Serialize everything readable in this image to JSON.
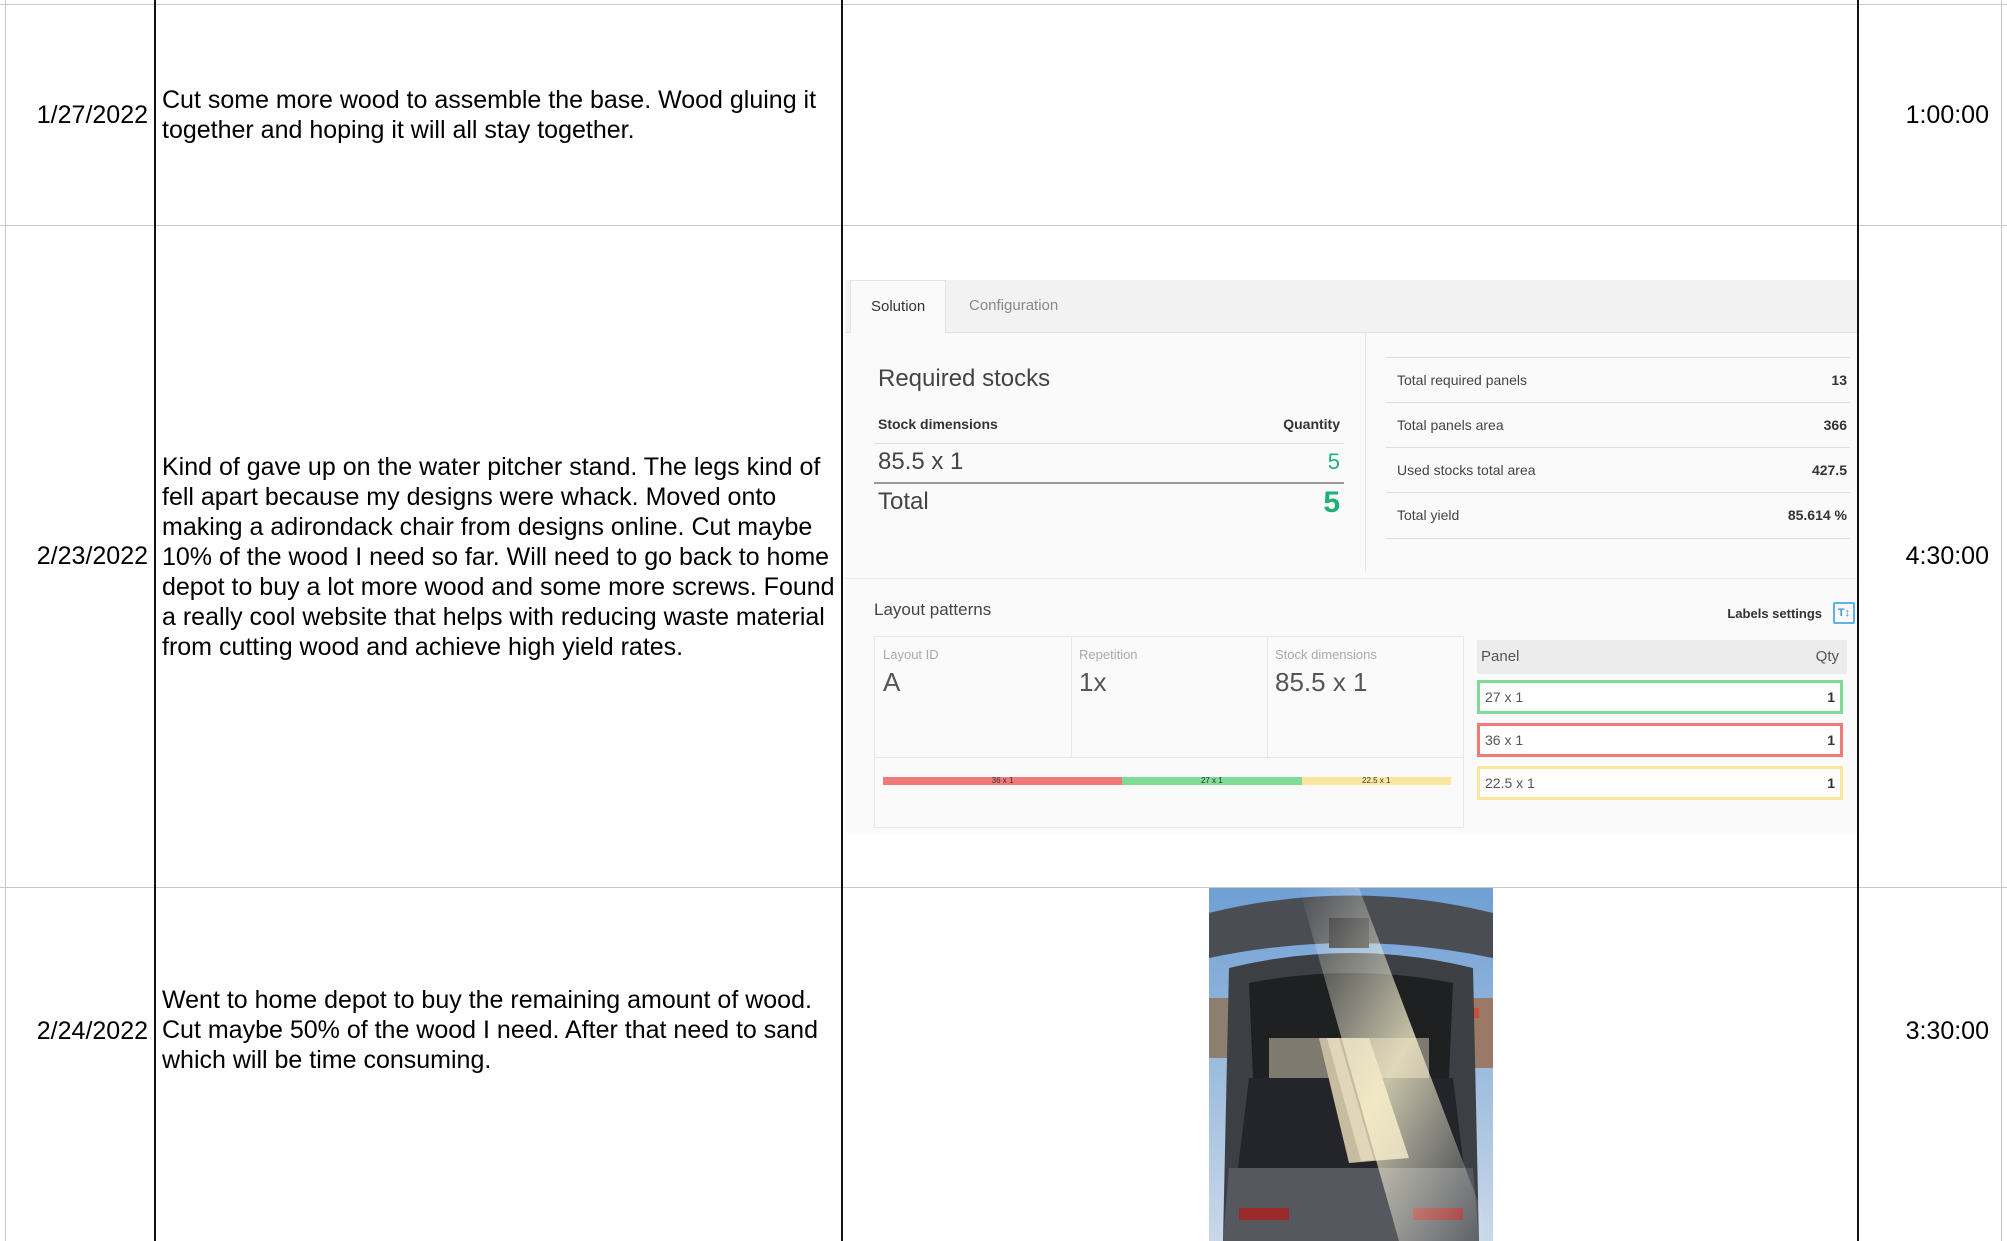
{
  "rows": [
    {
      "date": "1/27/2022",
      "description": "Cut some more wood to assemble the base. Wood gluing it together and hoping it will all stay together.",
      "duration": "1:00:00"
    },
    {
      "date": "2/23/2022",
      "description": "Kind of gave up on the water pitcher stand. The legs kind of fell apart because my designs were whack. Moved onto making a adirondack chair from designs online. Cut maybe 10% of the wood I need so far. Will need to go back to home depot to buy a lot more wood and some more screws. Found a really cool website that helps with reducing waste material from cutting wood and achieve high yield rates.",
      "duration": "4:30:00"
    },
    {
      "date": "2/24/2022",
      "description": "Went to home depot to buy the remaining amount of wood. Cut maybe 50% of the wood I need. After that need to sand which will be time consuming.",
      "duration": "3:30:00"
    }
  ],
  "cutlist_app": {
    "tabs": [
      "Solution",
      "Configuration"
    ],
    "required_stocks_title": "Required stocks",
    "stock_dimensions_header": "Stock dimensions",
    "quantity_header": "Quantity",
    "stock_row": {
      "dimensions": "85.5 x 1",
      "quantity": "5"
    },
    "total_label": "Total",
    "total_quantity": "5",
    "stats": [
      {
        "label": "Total required panels",
        "value": "13"
      },
      {
        "label": "Total panels area",
        "value": "366"
      },
      {
        "label": "Used stocks total area",
        "value": "427.5"
      },
      {
        "label": "Total yield",
        "value": "85.614 %"
      }
    ],
    "layout_patterns_title": "Layout patterns",
    "labels_settings": "Labels settings",
    "labels_icon_glyph": "T↕",
    "layout": {
      "layout_id_label": "Layout ID",
      "layout_id": "A",
      "repetition_label": "Repetition",
      "repetition": "1x",
      "stock_dimensions_label": "Stock dimensions",
      "stock_dimensions": "85.5 x 1"
    },
    "bar_segments": [
      {
        "label": "36 x 1",
        "length": 36,
        "color": "#f07a7a"
      },
      {
        "label": "27 x 1",
        "length": 27,
        "color": "#7fdb98"
      },
      {
        "label": "22.5 x 1",
        "length": 22.5,
        "color": "#fbe6a0"
      }
    ],
    "panel_header": "Panel",
    "qty_header": "Qty",
    "panels": [
      {
        "panel": "27 x 1",
        "qty": "1",
        "color": "#7fdb98"
      },
      {
        "panel": "36 x 1",
        "qty": "1",
        "color": "#f07a7a"
      },
      {
        "panel": "22.5 x 1",
        "qty": "1",
        "color": "#fbe6a0"
      }
    ]
  }
}
